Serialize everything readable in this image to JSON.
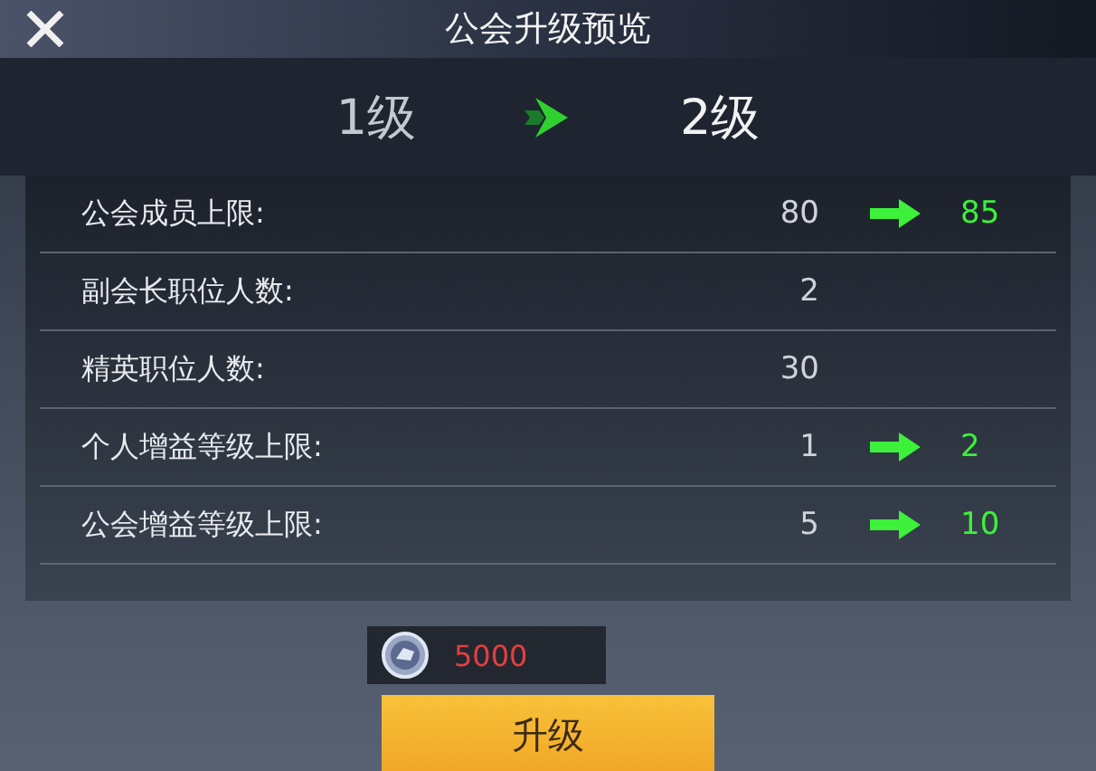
{
  "window": {
    "title": "公会升级预览"
  },
  "levels": {
    "current": "1级",
    "next": "2级"
  },
  "stats": [
    {
      "label": "公会成员上限:",
      "current": "80",
      "next": "85"
    },
    {
      "label": "副会长职位人数:",
      "current": "2"
    },
    {
      "label": "精英职位人数:",
      "current": "30"
    },
    {
      "label": "个人增益等级上限:",
      "current": "1",
      "next": "2"
    },
    {
      "label": "公会增益等级上限:",
      "current": "5",
      "next": "10"
    }
  ],
  "cost": {
    "amount": "5000"
  },
  "buttons": [
    "升级"
  ]
}
